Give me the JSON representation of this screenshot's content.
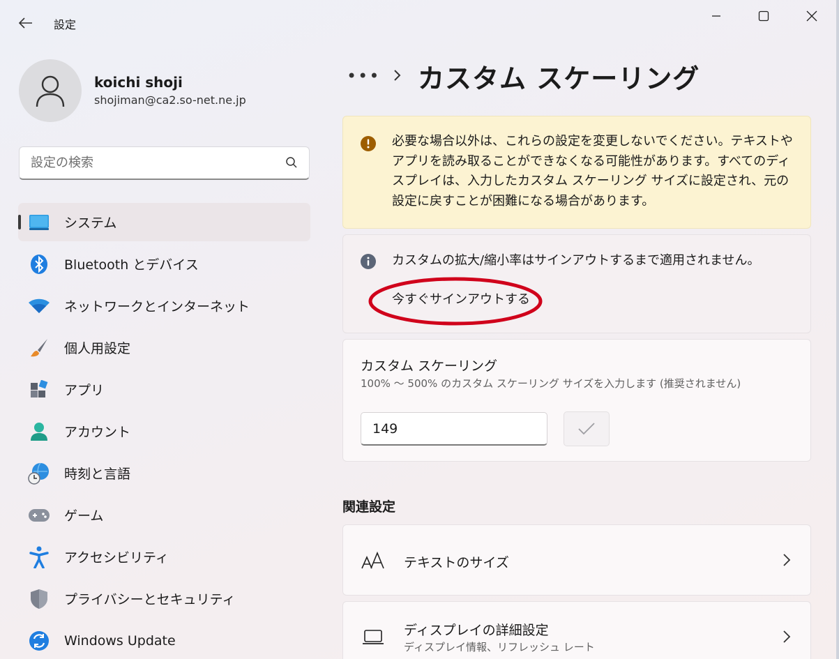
{
  "window": {
    "title": "設定"
  },
  "profile": {
    "name": "koichi shoji",
    "email": "shojiman@ca2.so-net.ne.jp"
  },
  "search": {
    "placeholder": "設定の検索"
  },
  "sidebar": {
    "items": [
      {
        "label": "システム",
        "icon": "system-display-icon",
        "active": true
      },
      {
        "label": "Bluetooth とデバイス",
        "icon": "bluetooth-icon"
      },
      {
        "label": "ネットワークとインターネット",
        "icon": "wifi-icon"
      },
      {
        "label": "個人用設定",
        "icon": "paintbrush-icon"
      },
      {
        "label": "アプリ",
        "icon": "apps-icon"
      },
      {
        "label": "アカウント",
        "icon": "account-icon"
      },
      {
        "label": "時刻と言語",
        "icon": "time-language-icon"
      },
      {
        "label": "ゲーム",
        "icon": "gamepad-icon"
      },
      {
        "label": "アクセシビリティ",
        "icon": "accessibility-icon"
      },
      {
        "label": "プライバシーとセキュリティ",
        "icon": "shield-icon"
      },
      {
        "label": "Windows Update",
        "icon": "windows-update-icon"
      }
    ]
  },
  "breadcrumb": {
    "more": "•••",
    "current": "カスタム スケーリング"
  },
  "warning": {
    "text": "必要な場合以外は、これらの設定を変更しないでください。テキストやアプリを読み取ることができなくなる可能性があります。すべてのディスプレイは、入力したカスタム スケーリング サイズに設定され、元の設定に戻すことが困難になる場合があります。"
  },
  "info": {
    "text": "カスタムの拡大/縮小率はサインアウトするまで適用されません。",
    "link": "今すぐサインアウトする"
  },
  "custom_scaling": {
    "title": "カスタム スケーリング",
    "description": "100% 〜 500% のカスタム スケーリング サイズを入力します (推奨されません)",
    "value": "149"
  },
  "related": {
    "heading": "関連設定",
    "items": [
      {
        "label": "テキストのサイズ",
        "icon": "text-size-icon"
      },
      {
        "label": "ディスプレイの詳細設定",
        "sublabel": "ディスプレイ情報、リフレッシュ レート",
        "icon": "laptop-icon"
      }
    ]
  },
  "colors": {
    "accent": "#0067c0",
    "warning_bg": "#fcf3d2",
    "warning_icon": "#9d5d00",
    "annotation": "#d0021b"
  }
}
